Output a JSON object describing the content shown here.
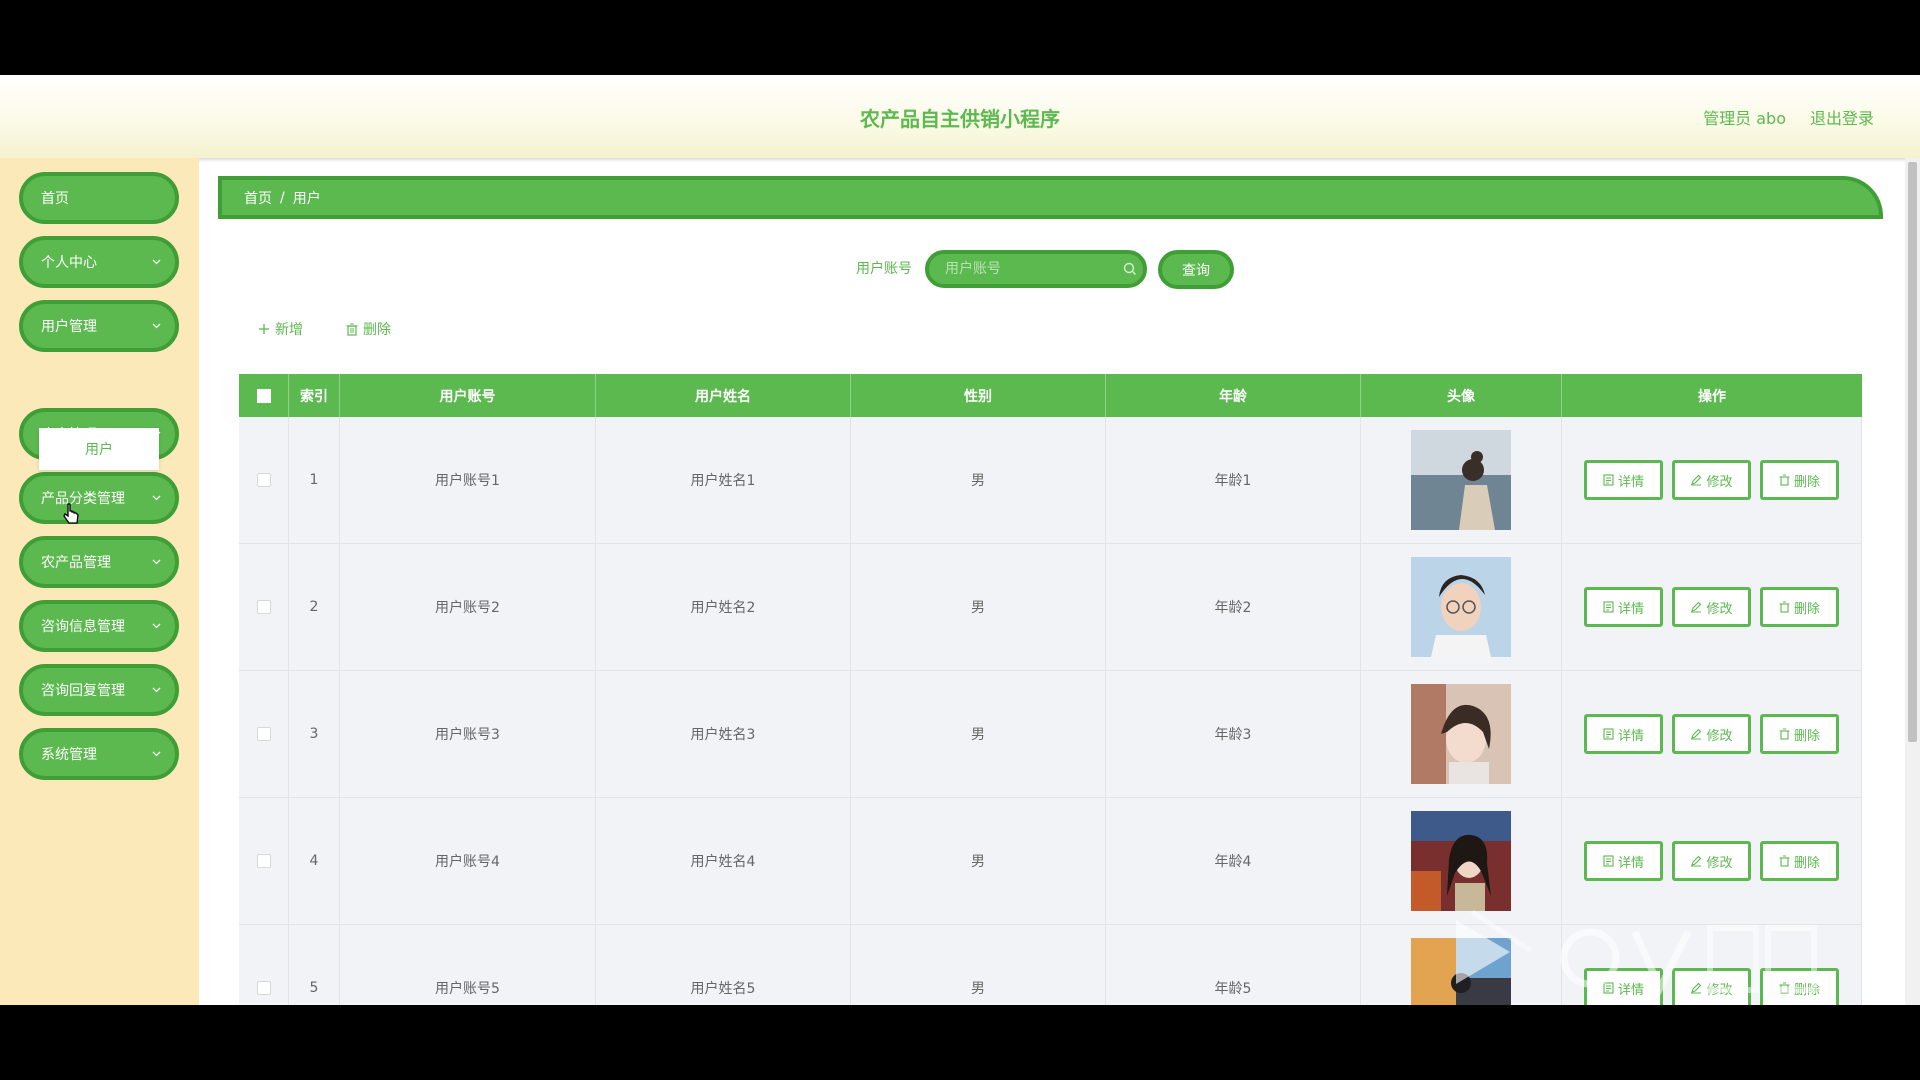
{
  "header": {
    "title": "农产品自主供销小程序",
    "user": "管理员 abo",
    "logout": "退出登录"
  },
  "sidebar": {
    "items": [
      {
        "label": "首页",
        "has_arrow": false
      },
      {
        "label": "个人中心",
        "has_arrow": true
      },
      {
        "label": "用户管理",
        "has_arrow": true
      },
      {
        "label": "农户管理",
        "has_arrow": true
      },
      {
        "label": "产品分类管理",
        "has_arrow": true
      },
      {
        "label": "农产品管理",
        "has_arrow": true
      },
      {
        "label": "咨询信息管理",
        "has_arrow": true
      },
      {
        "label": "咨询回复管理",
        "has_arrow": true
      },
      {
        "label": "系统管理",
        "has_arrow": true
      }
    ],
    "submenu": {
      "label": "用户"
    }
  },
  "breadcrumb": {
    "home": "首页",
    "sep": "/",
    "current": "用户"
  },
  "search": {
    "label": "用户账号",
    "placeholder": "用户账号",
    "button": "查询"
  },
  "actions": {
    "add": "新增",
    "delete": "删除"
  },
  "table": {
    "headers": [
      "索引",
      "用户账号",
      "用户姓名",
      "性别",
      "年龄",
      "头像",
      "操作"
    ],
    "rows": [
      {
        "index": "1",
        "account": "用户账号1",
        "name": "用户姓名1",
        "gender": "男",
        "age": "年龄1"
      },
      {
        "index": "2",
        "account": "用户账号2",
        "name": "用户姓名2",
        "gender": "男",
        "age": "年龄2"
      },
      {
        "index": "3",
        "account": "用户账号3",
        "name": "用户姓名3",
        "gender": "男",
        "age": "年龄3"
      },
      {
        "index": "4",
        "account": "用户账号4",
        "name": "用户姓名4",
        "gender": "男",
        "age": "年龄4"
      },
      {
        "index": "5",
        "account": "用户账号5",
        "name": "用户姓名5",
        "gender": "男",
        "age": "年龄5"
      }
    ],
    "row_actions": {
      "detail": "详情",
      "edit": "修改",
      "delete": "删除"
    }
  },
  "colors": {
    "primary": "#5cb94f",
    "primary_border": "#3f9e36",
    "sidebar_bg": "#fbe9b9",
    "row_bg": "#f2f3f7"
  },
  "icons": [
    "chevron-down-icon",
    "search-icon",
    "plus-icon",
    "trash-icon",
    "document-icon",
    "edit-icon",
    "cursor-icon"
  ]
}
